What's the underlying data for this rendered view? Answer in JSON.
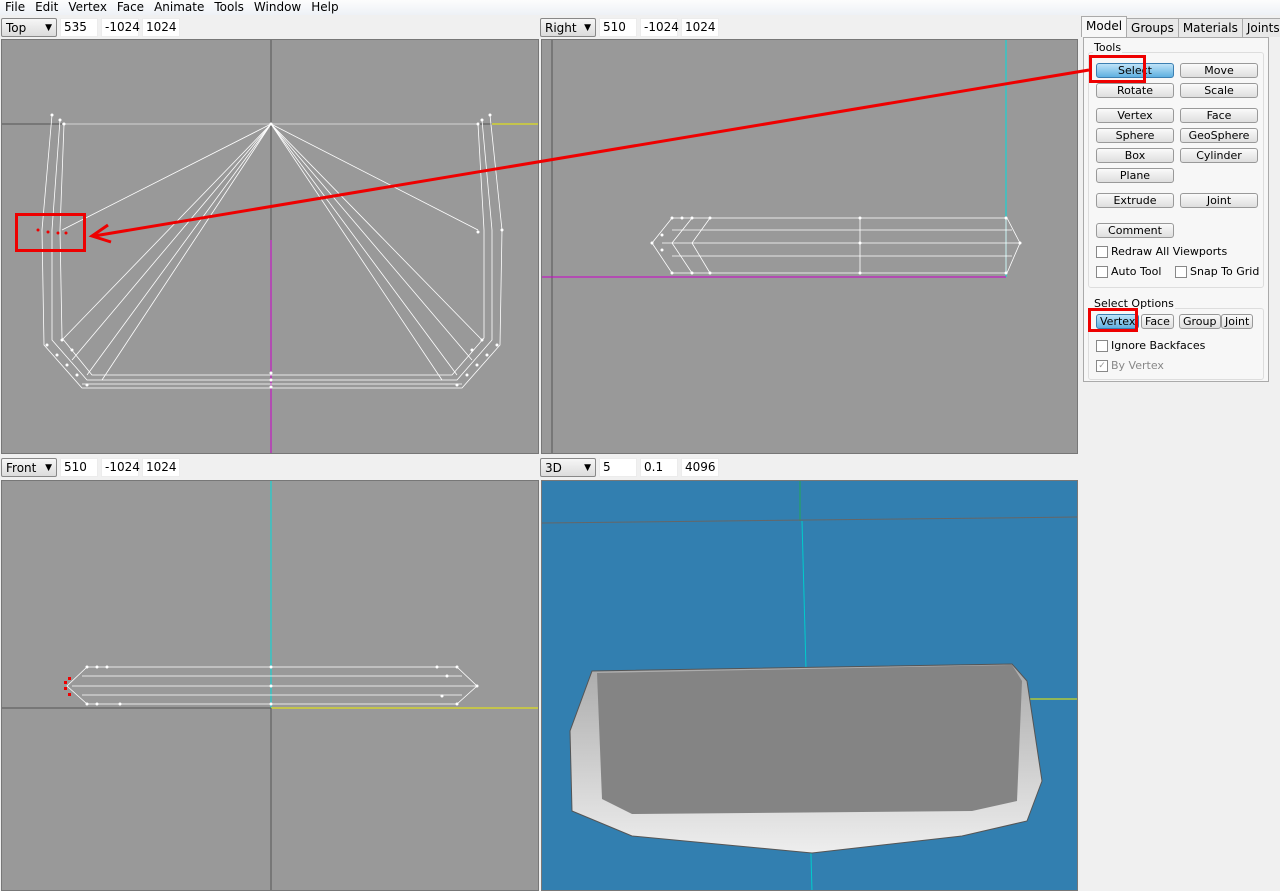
{
  "menu": [
    "File",
    "Edit",
    "Vertex",
    "Face",
    "Animate",
    "Tools",
    "Window",
    "Help"
  ],
  "viewports": [
    {
      "view": "Top",
      "v1": "535",
      "v2": "-1024",
      "v3": "1024"
    },
    {
      "view": "Right",
      "v1": "510",
      "v2": "-1024",
      "v3": "1024"
    },
    {
      "view": "Front",
      "v1": "510",
      "v2": "-1024",
      "v3": "1024"
    },
    {
      "view": "3D",
      "v1": "5",
      "v2": "0.1",
      "v3": "4096"
    }
  ],
  "tabs": [
    "Model",
    "Groups",
    "Materials",
    "Joints"
  ],
  "tools": {
    "label": "Tools",
    "select": "Select",
    "move": "Move",
    "rotate": "Rotate",
    "scale": "Scale",
    "vertex": "Vertex",
    "face": "Face",
    "sphere": "Sphere",
    "geosphere": "GeoSphere",
    "box": "Box",
    "cylinder": "Cylinder",
    "plane": "Plane",
    "extrude": "Extrude",
    "joint": "Joint",
    "comment": "Comment",
    "redraw": "Redraw All Viewports",
    "autotool": "Auto Tool",
    "snap": "Snap To Grid"
  },
  "select_options": {
    "label": "Select Options",
    "vertex": "Vertex",
    "face": "Face",
    "group": "Group",
    "joint": "Joint",
    "ignore_backfaces": "Ignore Backfaces",
    "by_vertex": "By Vertex",
    "by_vertex_checked": true
  },
  "colors": {
    "viewport_bg": "#999999",
    "viewport_3d_bg": "#327fb0",
    "annotation": "#e00000",
    "selected_button": "#5fb0e0"
  }
}
